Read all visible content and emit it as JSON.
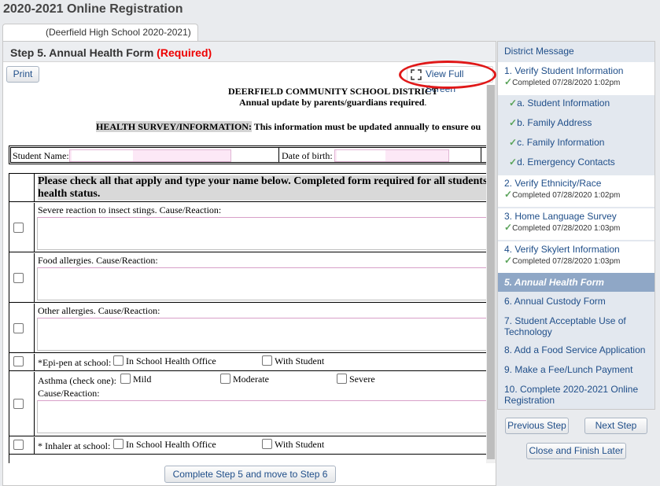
{
  "page_title": "2020-2021 Online Registration",
  "school_tab": "(Deerfield High School 2020-2021)",
  "step_header": {
    "title": "Step 5. Annual Health Form",
    "required": "(Required)"
  },
  "buttons": {
    "print": "Print",
    "view_full_screen": "View Full Screen",
    "complete_step": "Complete Step 5 and move to Step 6",
    "previous_step": "Previous Step",
    "next_step": "Next Step",
    "close_finish": "Close and Finish Later"
  },
  "form": {
    "district": "DEERFIELD COMMUNITY SCHOOL DISTRICT",
    "annual_note": "Annual update by parents/guardians required",
    "annual_note_period": ".",
    "survey_label": "HEALTH SURVEY/INFORMATION:",
    "survey_text": " This information must be updated annually to ensure ou",
    "student_name_label": "Student Name:",
    "dob_label": "Date of birth:",
    "table_header": "Please check all that apply and type your name below. Completed form required for all students",
    "table_header_2": "health status.",
    "rows": {
      "insect": "Severe reaction to insect stings. Cause/Reaction:",
      "food": "Food allergies. Cause/Reaction:",
      "other": "Other allergies. Cause/Reaction:",
      "epipen_label": "*Epi-pen at school:",
      "epipen_opt1": "In School Health Office",
      "epipen_opt2": "With Student",
      "asthma_label": "Asthma (check one):",
      "asthma_opt1": "Mild",
      "asthma_opt2": "Moderate",
      "asthma_opt3": "Severe",
      "asthma_cause": "Cause/Reaction:",
      "inhaler_label": "* Inhaler at school:",
      "inhaler_opt1": "In School Health Office",
      "inhaler_opt2": "With Student"
    }
  },
  "sidebar": {
    "district_message": "District Message",
    "step1": "1. Verify Student Information",
    "step1_done": "Completed 07/28/2020 1:02pm",
    "step1a": "a. Student Information",
    "step1b": "b. Family Address",
    "step1c": "c. Family Information",
    "step1d": "d. Emergency Contacts",
    "step2": "2. Verify Ethnicity/Race",
    "step2_done": "Completed 07/28/2020 1:02pm",
    "step3": "3. Home Language Survey",
    "step3_done": "Completed 07/28/2020 1:03pm",
    "step4": "4. Verify Skylert Information",
    "step4_done": "Completed 07/28/2020 1:03pm",
    "step5": "5. Annual Health Form",
    "step6": "6. Annual Custody Form",
    "step7_line1": "7. Student Acceptable Use of",
    "step7_line2": "Technology",
    "step8": "8. Add a Food Service Application",
    "step9": "9. Make a Fee/Lunch Payment",
    "step10_line1": "10. Complete 2020-2021 Online",
    "step10_line2": "Registration"
  },
  "colors": {
    "link": "#1f4e89",
    "active_step": "#8fa7c6",
    "required": "#e00000",
    "highlight": "#e01818"
  },
  "icons": {
    "fullscreen": "expand-icon",
    "completed": "checkmark-icon"
  }
}
